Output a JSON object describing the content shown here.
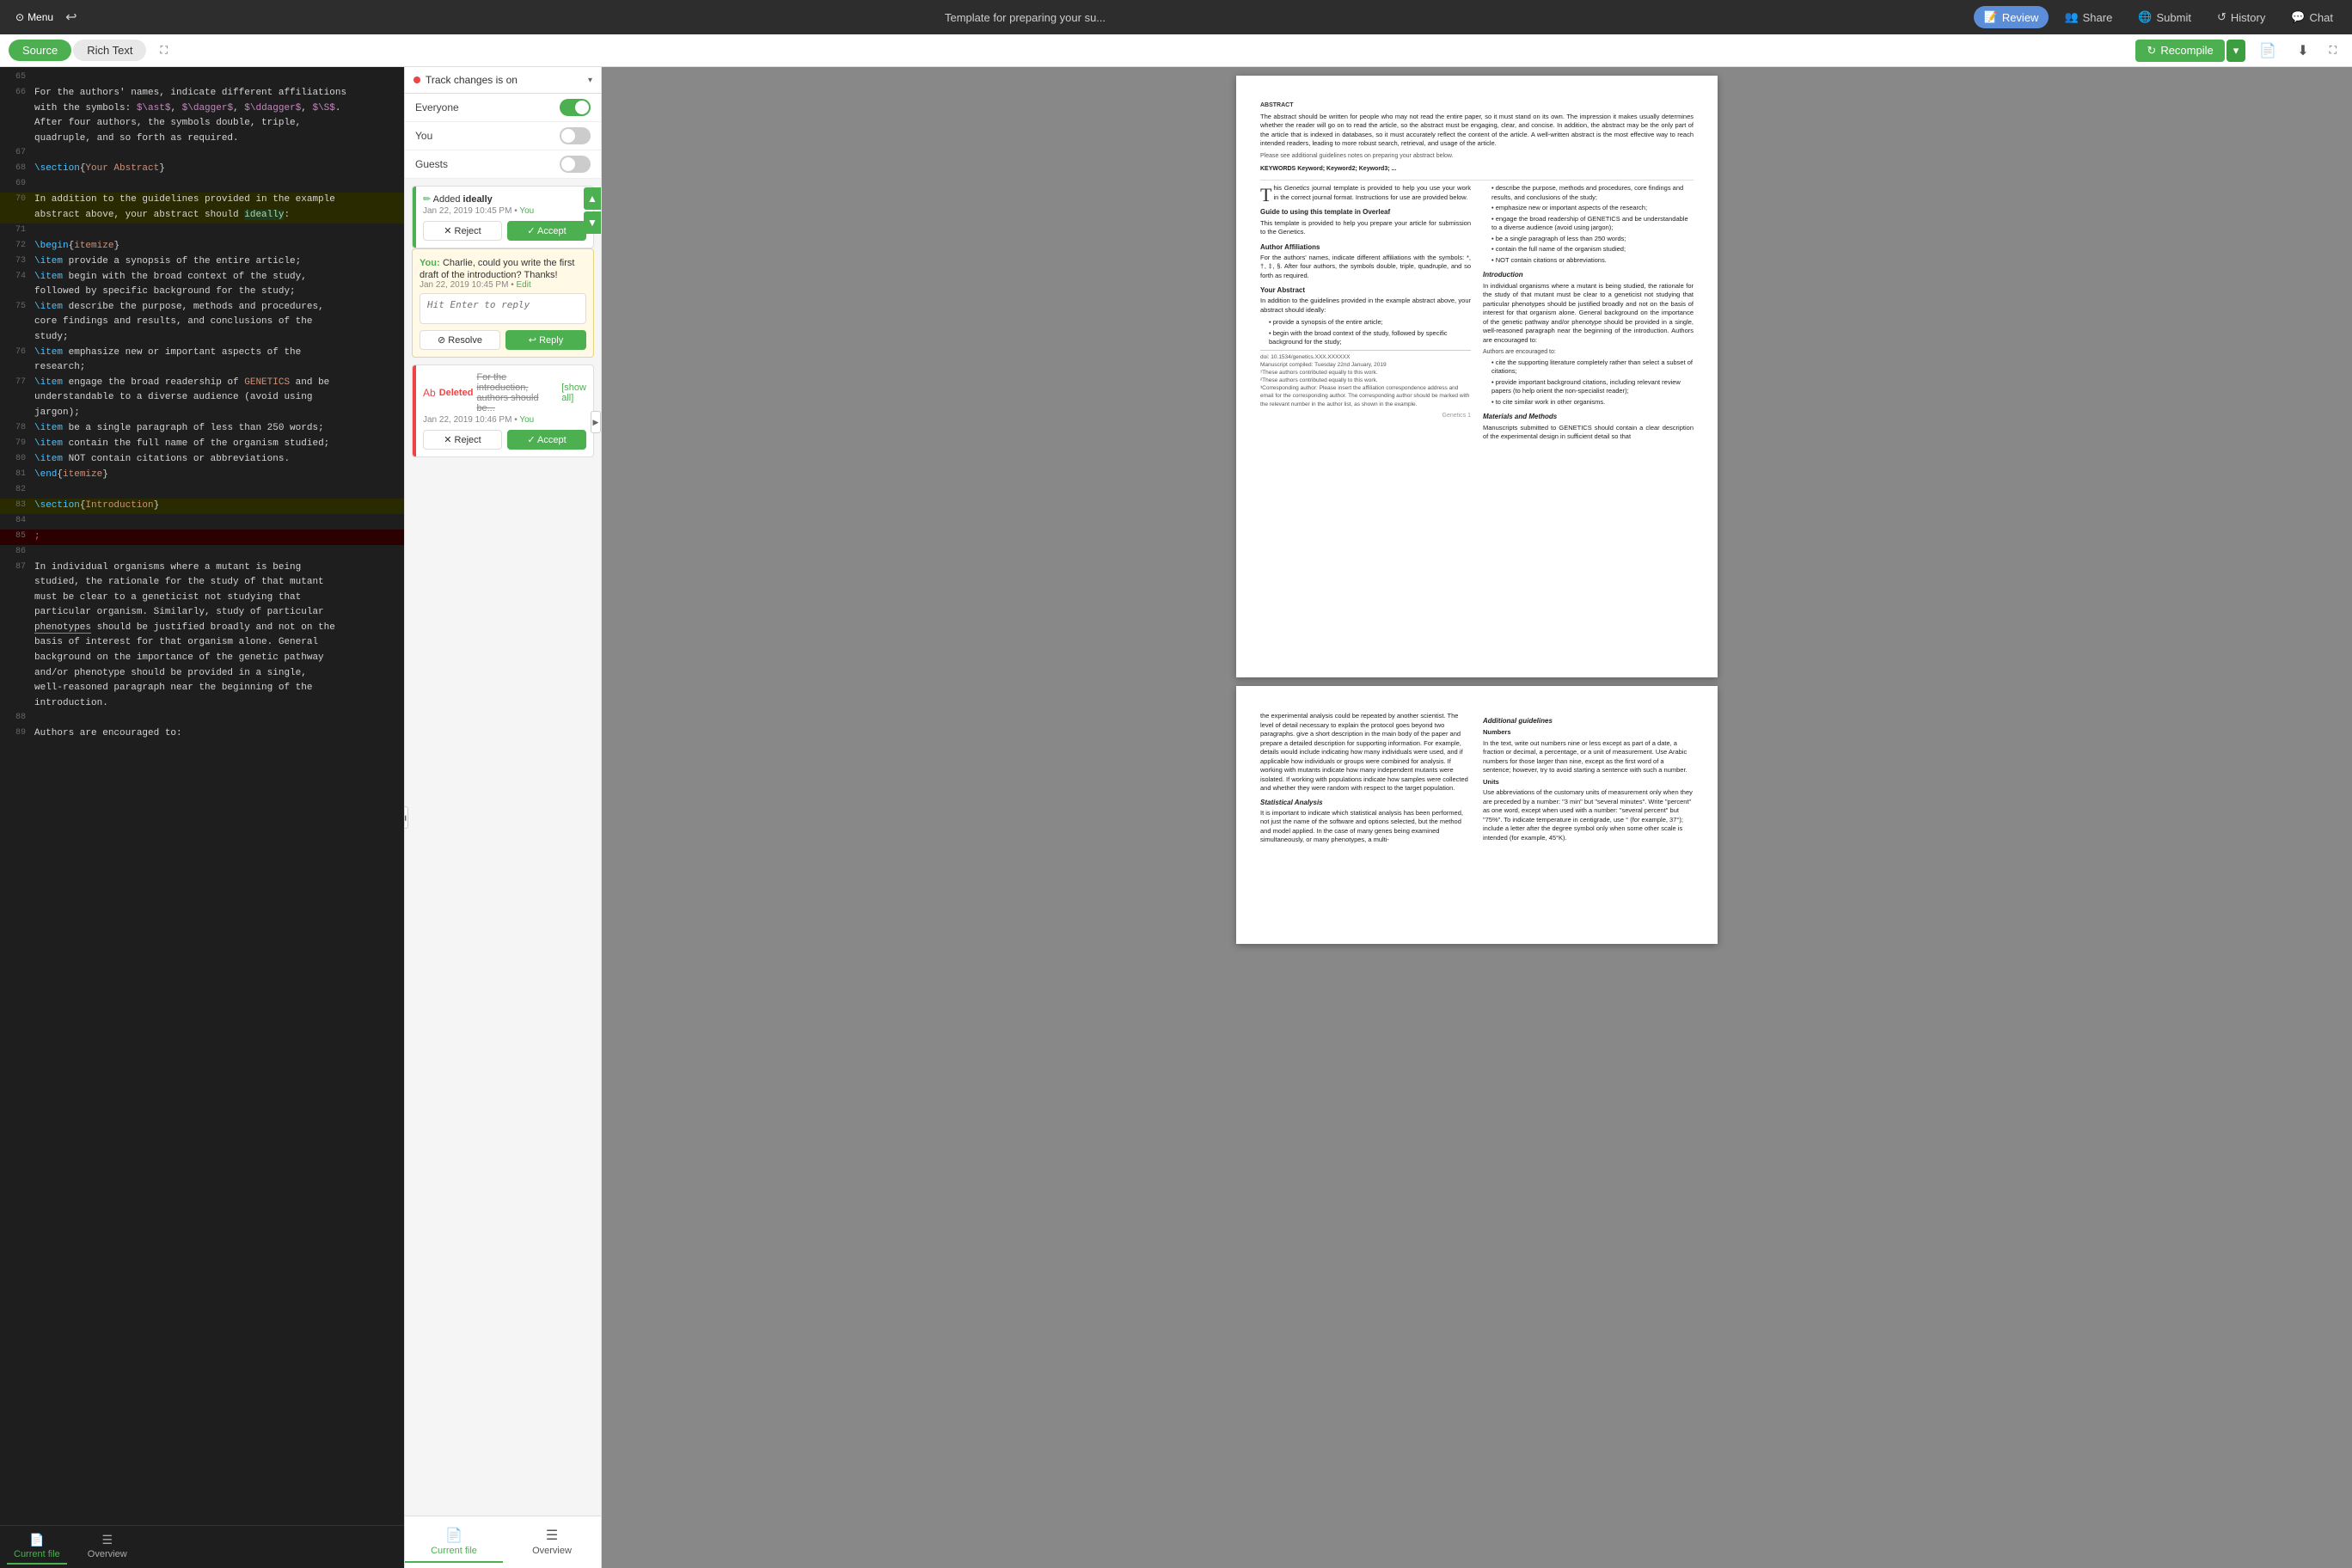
{
  "topnav": {
    "menu_label": "Menu",
    "title": "Template for preparing your su...",
    "review_label": "Review",
    "share_label": "Share",
    "submit_label": "Submit",
    "history_label": "History",
    "chat_label": "Chat"
  },
  "toolbar": {
    "source_tab": "Source",
    "richtext_tab": "Rich Text",
    "recompile_label": "Recompile",
    "expand_icon": "⛶"
  },
  "track": {
    "status": "Track changes is on",
    "everyone_label": "Everyone",
    "you_label": "You",
    "guests_label": "Guests",
    "everyone_on": true,
    "you_on": false,
    "guests_on": false
  },
  "changes": {
    "added": {
      "title": "Added ideally",
      "meta": "Jan 22, 2019 10:45 PM",
      "author": "You",
      "reject_label": "✕ Reject",
      "accept_label": "✓ Accept"
    },
    "comment": {
      "author": "You:",
      "text": "Charlie, could you write the first draft of the introduction? Thanks!",
      "meta": "Jan 22, 2019 10:45 PM",
      "edit_label": "Edit",
      "reply_placeholder": "Hit Enter to reply",
      "resolve_label": "⊘ Resolve",
      "reply_label": "↩ Reply"
    },
    "deleted": {
      "label": "Deleted",
      "text": "For the introduction, authors should be...",
      "show_all": "[show all]",
      "meta": "Jan 22, 2019 10:46 PM",
      "author": "You",
      "reject_label": "✕ Reject",
      "accept_label": "✓ Accept"
    }
  },
  "footer_tabs": {
    "current_file": "Current file",
    "overview": "Overview"
  },
  "source_lines": [
    {
      "num": "65",
      "content": "",
      "type": "normal"
    },
    {
      "num": "66",
      "content": "For the authors' names, indicate different affiliations\nwith the symbols: $\\ast$, $\\dagger$, $\\ddagger$, $\\S$.\nAfter four authors, the symbols double, triple,\nquadruple, and so forth as required.",
      "type": "normal"
    },
    {
      "num": "67",
      "content": "",
      "type": "normal"
    },
    {
      "num": "68",
      "content": "\\section{Your Abstract}",
      "type": "normal"
    },
    {
      "num": "69",
      "content": "",
      "type": "normal"
    },
    {
      "num": "70",
      "content": "In addition to the guidelines provided in the example\nabstract above, your abstract should ideally:",
      "type": "modified"
    },
    {
      "num": "71",
      "content": "",
      "type": "normal"
    },
    {
      "num": "72",
      "content": "\\begin{itemize}",
      "type": "normal"
    },
    {
      "num": "73",
      "content": "\\item provide a synopsis of the entire article;",
      "type": "normal"
    },
    {
      "num": "74",
      "content": "\\item begin with the broad context of the study,\nfollowed by specific background for the study;",
      "type": "normal"
    },
    {
      "num": "75",
      "content": "\\item describe the purpose, methods and procedures,\ncore findings and results, and conclusions of the\nstudy;",
      "type": "normal"
    },
    {
      "num": "76",
      "content": "\\item emphasize new or important aspects of the\nresearch;",
      "type": "normal"
    },
    {
      "num": "77",
      "content": "\\item engage the broad readership of GENETICS and be\nunderstandable to a diverse audience (avoid using\njargon);",
      "type": "normal"
    },
    {
      "num": "78",
      "content": "\\item be a single paragraph of less than 250 words;",
      "type": "normal"
    },
    {
      "num": "79",
      "content": "\\item contain the full name of the organism studied;",
      "type": "normal"
    },
    {
      "num": "80",
      "content": "\\item NOT contain citations or abbreviations.",
      "type": "normal"
    },
    {
      "num": "81",
      "content": "\\end{itemize}",
      "type": "normal"
    },
    {
      "num": "82",
      "content": "",
      "type": "normal"
    },
    {
      "num": "83",
      "content": "\\section{Introduction}",
      "type": "modified"
    },
    {
      "num": "84",
      "content": "",
      "type": "normal"
    },
    {
      "num": "85",
      "content": ";",
      "type": "deleted"
    },
    {
      "num": "86",
      "content": "",
      "type": "normal"
    },
    {
      "num": "87",
      "content": "In individual organisms where a mutant is being\nstudied, the rationale for the study of that mutant\nmust be clear to a geneticist not studying that\nparticular organism. Similarly, study of particular\nphenotypes should be justified broadly and not on the\nbasis of interest for that organism alone. General\nbackground on the importance of the genetic pathway\nand/or phenotype should be provided in a single,\nwell-reasoned paragraph near the beginning of the\nintroduction.",
      "type": "normal"
    },
    {
      "num": "88",
      "content": "",
      "type": "normal"
    },
    {
      "num": "89",
      "content": "Authors are encouraged to:",
      "type": "normal"
    }
  ],
  "pdf": {
    "abstract_title": "ABSTRACT",
    "abstract_text": "The abstract should be written for people who may not read the entire paper, so it must stand on its own. The impression it makes usually determines whether the reader will go on to read the article, so the abstract must be engaging, clear, and concise. In addition, the abstract may be the only part of the article that is indexed in databases, so it must accurately reflect the content of the article. A well-written abstract is the most effective way to reach intended readers, leading to more robust search, retrieval, and usage of the article.",
    "see_also": "Please see additional guidelines notes on preparing your abstract below.",
    "keywords_label": "KEYWORDS",
    "keywords_text": "Keyword; Keyword2; Keyword3; ...",
    "guide_title": "Guide to using this template in Overleaf",
    "guide_text": "This template is provided to help you prepare your article for submission to the Genetics.",
    "affiliations_title": "Author Affiliations",
    "affiliations_text": "For the authors' names, indicate different affiliations with the symbols: *, †, ‡, §. After four authors, the symbols double, triple, quadruple, and so forth as required.",
    "abstract_section_title": "Your Abstract",
    "abstract_section_text": "In addition to the guidelines provided in the example abstract above, your abstract should ideally:",
    "bullets_left": [
      "provide a synopsis of the entire article;",
      "begin with the broad context of the study, followed by specific background for the study;"
    ],
    "doi_text": "doi: 10.1534/genetics.XXX.XXXXXX",
    "manuscript_text": "Manuscript compiled: Tuesday 22nd January, 2019",
    "footnotes": [
      "¹These authors contributed equally to this work.",
      "²These authors contributed equally to this work.",
      "³Corresponding author: Please insert the affiliation correspondence address and email for the corresponding author. The corresponding author should be marked with the relevant number in the author list, as shown in the example."
    ],
    "intro_title": "Introduction",
    "intro_text": "In individual organisms where a mutant is being studied, the rationale for the study of that mutant must be clear to a geneticist not studying that particular phenotypes should be justified broadly and not on the basis of interest for that organism alone. General background on the importance of the genetic pathway and/or phenotype should be provided in a single, well-reasoned paragraph near the beginning of the introduction. Authors are encouraged to:",
    "cite_bullets": [
      "cite the supporting literature completely rather than select a subset of citations;",
      "provide important background citations, including relevant review papers (to help orient the non-specialist reader);",
      "to cite similar work in other organisms."
    ],
    "materials_title": "Materials and Methods",
    "materials_text": "Manuscripts submitted to GENETICS should contain a clear description of the experimental design in sufficient detail so that",
    "page_num": "Genetics    1",
    "page2_text": "the experimental analysis could be repeated by another scientist. The level of detail necessary to explain the protocol goes beyond two paragraphs. give a short description in the main body of the paper and prepare a detailed description for supporting information. For example, details would include indicating how many individuals were used, and if applicable how individuals or groups were combined for analysis. If working with mutants indicate how many independent mutants were isolated. If working with populations indicate how samples were collected and whether they were random with respect to the target population.",
    "additional_title": "Additional guidelines",
    "numbers_title": "Numbers",
    "numbers_text": "In the text, write out numbers nine or less except as part of a date, a fraction or decimal, a percentage, or a unit of measurement. Use Arabic numbers for those larger than nine, except as the first word of a sentence; however, try to avoid starting a sentence with such a number.",
    "units_title": "Units",
    "units_text": "Use abbreviations of the customary units of measurement only when they are preceded by a number: \"3 min\" but \"several minutes\". Write \"percent\" as one word, except when used with a number: \"several percent\" but \"75%\". To indicate temperature in centigrade, use ° (for example, 37°); include a letter after the degree symbol only when some other scale is intended (for example, 45°K).",
    "stats_title": "Statistical Analysis",
    "stats_text": "It is important to indicate which statistical analysis has been performed, not just the name of the software and options selected, but the method and model applied. In the case of many genes being examined simultaneously, or many phenotypes, a multi-",
    "right_col_bullets": [
      "describe the purpose, methods and procedures, core findings and results, and conclusions of the study;",
      "emphasize new or important aspects of the research;",
      "engage the broad readership of GENETICS and be understandable to a diverse audience (avoid using jargon);",
      "be a single paragraph of less than 250 words;",
      "contain the full name of the organism studied;",
      "NOT contain citations or abbreviations."
    ]
  }
}
